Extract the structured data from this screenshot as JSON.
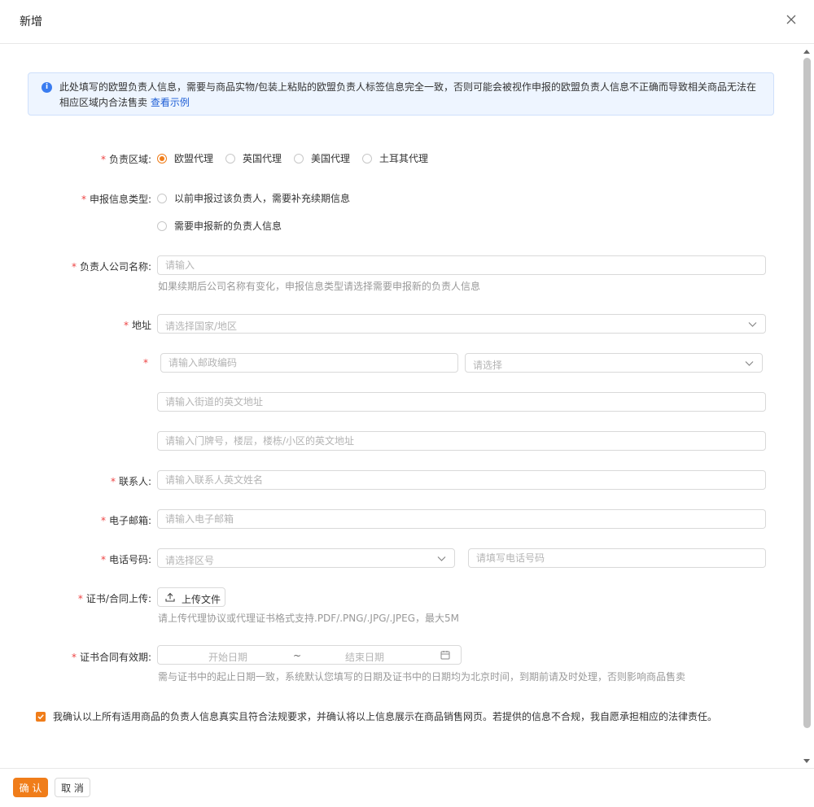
{
  "dialog": {
    "title": "新增",
    "close_icon": "close-icon"
  },
  "notice": {
    "icon": "info-icon",
    "text": "此处填写的欧盟负责人信息，需要与商品实物/包装上粘贴的欧盟负责人标签信息完全一致，否则可能会被视作申报的欧盟负责人信息不正确而导致相关商品无法在相应区域内合法售卖",
    "link_text": "查看示例",
    "colors": {
      "bg": "#eef5ff",
      "icon": "#3a7cf0",
      "link": "#1f5fd6"
    }
  },
  "form": {
    "required_mark": "*",
    "region": {
      "label": "负责区域:",
      "options": [
        "欧盟代理",
        "英国代理",
        "美国代理",
        "土耳其代理"
      ],
      "selected": "欧盟代理"
    },
    "declare_type": {
      "label": "申报信息类型:",
      "options": [
        "以前申报过该负责人，需要补充续期信息",
        "需要申报新的负责人信息"
      ],
      "selected": ""
    },
    "company": {
      "label": "负责人公司名称:",
      "placeholder": "请输入",
      "hint": "如果续期后公司名称有变化，申报信息类型请选择需要申报新的负责人信息"
    },
    "address": {
      "label": "地址",
      "country_placeholder": "请选择国家/地区",
      "postcode_placeholder": "请输入邮政编码",
      "select_placeholder": "请选择",
      "street_placeholder": "请输入街道的英文地址",
      "house_placeholder": "请输入门牌号，楼层，楼栋/小区的英文地址"
    },
    "contact": {
      "label": "联系人:",
      "placeholder": "请输入联系人英文姓名"
    },
    "email": {
      "label": "电子邮箱:",
      "placeholder": "请输入电子邮箱"
    },
    "phone": {
      "label": "电话号码:",
      "area_placeholder": "请选择区号",
      "number_placeholder": "请填写电话号码"
    },
    "certificate": {
      "label": "证书/合同上传:",
      "button": "上传文件",
      "hint": "请上传代理协议或代理证书格式支持.PDF/.PNG/.JPG/.JPEG，最大5M"
    },
    "validity": {
      "label": "证书合同有效期:",
      "start_placeholder": "开始日期",
      "separator": "~",
      "end_placeholder": "结束日期",
      "hint": "需与证书中的起止日期一致，系统默认您填写的日期及证书中的日期均为北京时间，到期前请及时处理，否则影响商品售卖"
    },
    "consent": {
      "checked": true,
      "text": "我确认以上所有适用商品的负责人信息真实且符合法规要求，并确认将以上信息展示在商品销售网页。若提供的信息不合规，我自愿承担相应的法律责任。"
    }
  },
  "footer": {
    "confirm": "确 认",
    "cancel": "取 消"
  },
  "colors": {
    "accent": "#f07d1a",
    "required": "#e44444",
    "hint": "#999999",
    "placeholder": "#b4b4b4"
  }
}
